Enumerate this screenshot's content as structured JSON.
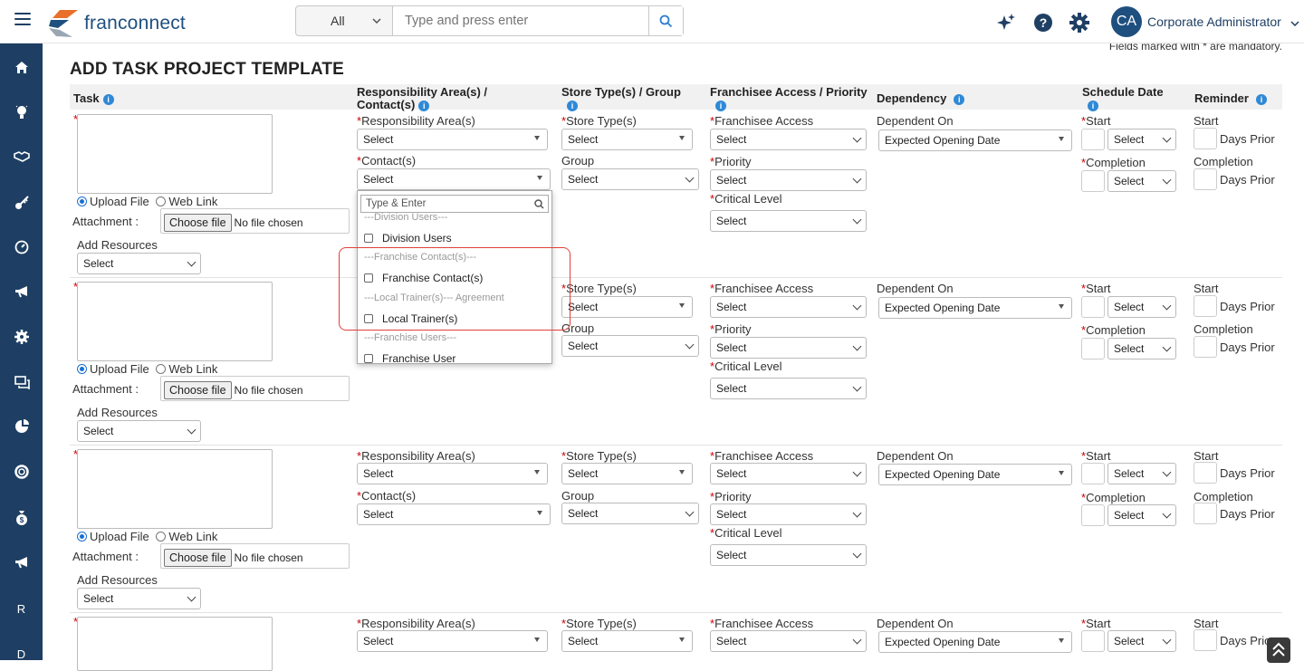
{
  "header": {
    "brand": "franconnect",
    "search_scope": "All",
    "search_placeholder": "Type and press enter",
    "user_initials": "CA",
    "user_name": "Corporate Administrator"
  },
  "sidebar": {
    "icons": [
      "home-icon",
      "lightbulb-icon",
      "handshake-icon",
      "key-icon",
      "gauge-icon",
      "megaphone-icon",
      "gear-icon",
      "chat-icon",
      "pie-icon",
      "lifebuoy-icon",
      "money-bag-icon",
      "megaphone-icon"
    ],
    "letters": [
      "R",
      "D"
    ]
  },
  "page": {
    "mandatory_note": "Fields marked with * are mandatory.",
    "title": "ADD TASK PROJECT TEMPLATE"
  },
  "columns": {
    "task": "Task",
    "resp_line1": "Responsibility Area(s) /",
    "resp_line2": "Contact(s)",
    "store": "Store Type(s) / Group",
    "franchisee": "Franchisee Access / Priority",
    "dependency": "Dependency",
    "schedule": "Schedule Date",
    "reminder": "Reminder"
  },
  "labels": {
    "asterisk": "*",
    "upload_file": "Upload File",
    "web_link": "Web Link",
    "attachment": "Attachment :",
    "choose_file": "Choose file",
    "no_file": "No file chosen",
    "add_resources": "Add Resources",
    "resp_area": "Responsibility Area(s)",
    "contacts": "Contact(s)",
    "store_types": "Store Type(s)",
    "group": "Group",
    "franchisee_access": "Franchisee Access",
    "priority": "Priority",
    "critical_level": "Critical Level",
    "dependent_on": "Dependent On",
    "start": "Start",
    "completion": "Completion",
    "days_prior": "Days Prior",
    "select": "Select",
    "expected_opening": "Expected Opening Date"
  },
  "dropdown": {
    "search_placeholder": "Type & Enter",
    "items": [
      {
        "type": "group",
        "label": "---Division Users---"
      },
      {
        "type": "option",
        "label": "Division Users"
      },
      {
        "type": "group",
        "label": "---Franchise Contact(s)---"
      },
      {
        "type": "option",
        "label": "Franchise Contact(s)"
      },
      {
        "type": "group",
        "label": "---Local Trainer(s)--- Agreement"
      },
      {
        "type": "option",
        "label": "Local Trainer(s)"
      },
      {
        "type": "group",
        "label": "---Franchise Users---"
      },
      {
        "type": "option",
        "label": "Franchise User"
      }
    ]
  },
  "colors": {
    "sidebar": "#1e3f63",
    "brand": "#1f4f7f",
    "info": "#2e89d6",
    "highlight": "#e0403c"
  }
}
